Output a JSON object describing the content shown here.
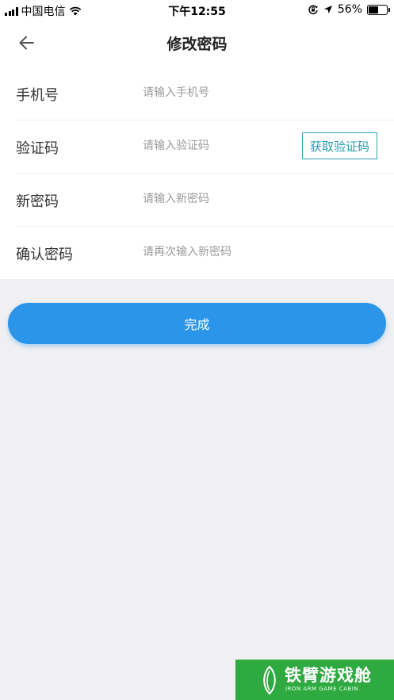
{
  "status_bar": {
    "carrier": "中国电信",
    "time": "下午12:55",
    "battery": "56%",
    "battery_level": 0.56,
    "icons": [
      "signal-icon",
      "wifi-icon",
      "rotation-lock-icon",
      "location-icon",
      "battery-icon"
    ]
  },
  "nav": {
    "back_icon": "back-arrow-icon",
    "title": "修改密码"
  },
  "form": {
    "phone": {
      "label": "手机号",
      "placeholder": "请输入手机号",
      "value": ""
    },
    "code": {
      "label": "验证码",
      "placeholder": "请输入验证码",
      "value": "",
      "button": "获取验证码"
    },
    "new_password": {
      "label": "新密码",
      "placeholder": "请输入新密码",
      "value": ""
    },
    "confirm_password": {
      "label": "确认密码",
      "placeholder": "请再次输入新密码",
      "value": ""
    }
  },
  "submit_label": "完成",
  "watermark": {
    "title": "铁臂游戏舱",
    "subtitle": "IRON ARM GAME CABIN"
  },
  "colors": {
    "accent": "#2b95ea",
    "code_button": "#34a2b4",
    "background": "#f0f0f2",
    "watermark_bg": "#2eaa40"
  }
}
